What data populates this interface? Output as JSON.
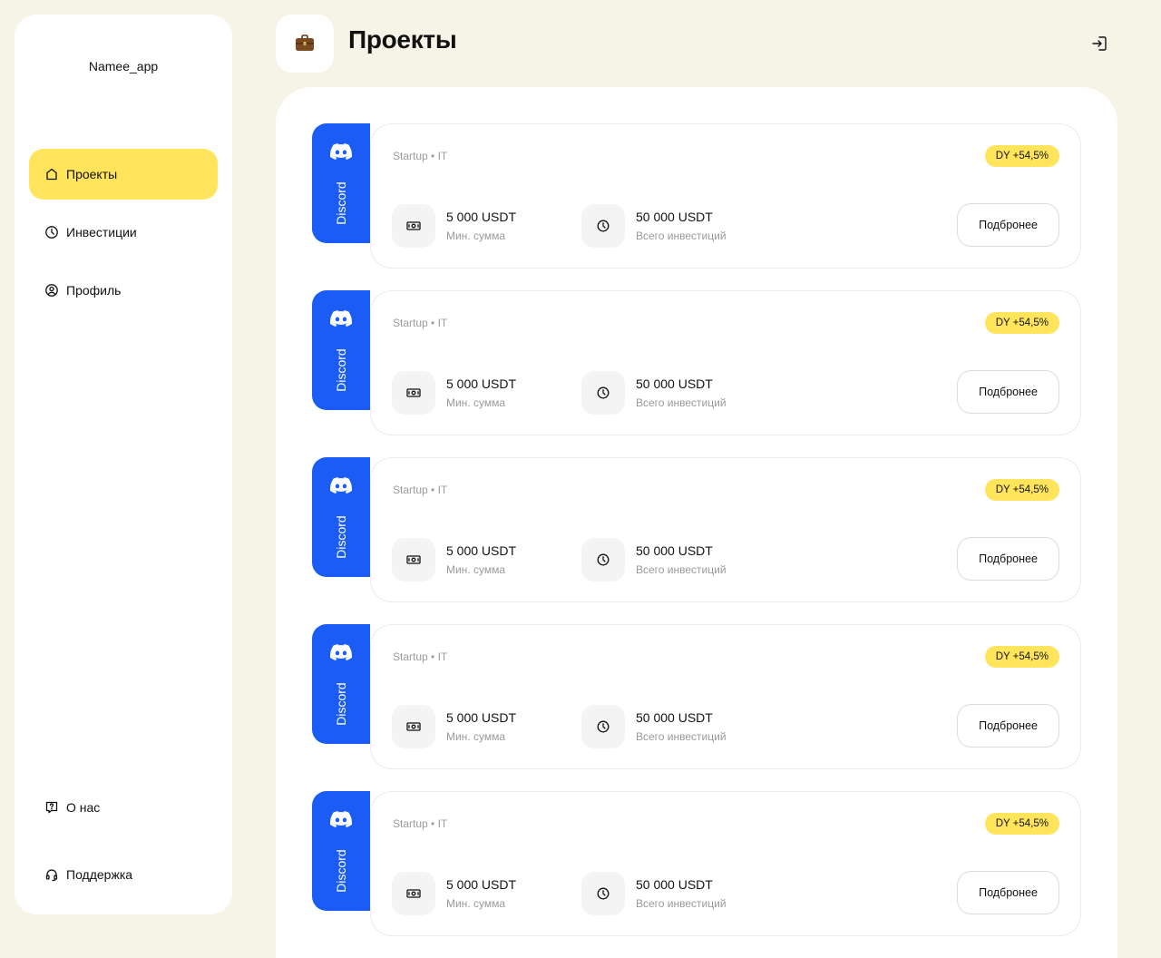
{
  "sidebar": {
    "brand": "Namee_app",
    "nav": [
      {
        "label": "Проекты",
        "icon": "home-icon",
        "active": true
      },
      {
        "label": "Инвестиции",
        "icon": "clock-icon",
        "active": false
      },
      {
        "label": "Профиль",
        "icon": "user-circle-icon",
        "active": false
      }
    ],
    "bottom": [
      {
        "label": "О нас",
        "icon": "question-icon"
      },
      {
        "label": "Поддержка",
        "icon": "headset-icon"
      }
    ]
  },
  "header": {
    "title": "Проекты",
    "icon": "briefcase-icon",
    "logout_icon": "logout-icon"
  },
  "colors": {
    "background": "#f6f3e7",
    "accent_yellow": "#ffe45c",
    "accent_blue": "#1a5cf5"
  },
  "projects": [
    {
      "platform": "Discord",
      "category": "Startup",
      "sector": "IT",
      "badge": "DY +54,5%",
      "min_value": "5 000 USDT",
      "min_label": "Мин. сумма",
      "total_value": "50 000 USDT",
      "total_label": "Всего инвестиций",
      "button": "Подбронее"
    },
    {
      "platform": "Discord",
      "category": "Startup",
      "sector": "IT",
      "badge": "DY +54,5%",
      "min_value": "5 000 USDT",
      "min_label": "Мин. сумма",
      "total_value": "50 000 USDT",
      "total_label": "Всего инвестиций",
      "button": "Подбронее"
    },
    {
      "platform": "Discord",
      "category": "Startup",
      "sector": "IT",
      "badge": "DY +54,5%",
      "min_value": "5 000 USDT",
      "min_label": "Мин. сумма",
      "total_value": "50 000 USDT",
      "total_label": "Всего инвестиций",
      "button": "Подбронее"
    },
    {
      "platform": "Discord",
      "category": "Startup",
      "sector": "IT",
      "badge": "DY +54,5%",
      "min_value": "5 000 USDT",
      "min_label": "Мин. сумма",
      "total_value": "50 000 USDT",
      "total_label": "Всего инвестиций",
      "button": "Подбронее"
    },
    {
      "platform": "Discord",
      "category": "Startup",
      "sector": "IT",
      "badge": "DY +54,5%",
      "min_value": "5 000 USDT",
      "min_label": "Мин. сумма",
      "total_value": "50 000 USDT",
      "total_label": "Всего инвестиций",
      "button": "Подбронее"
    }
  ]
}
